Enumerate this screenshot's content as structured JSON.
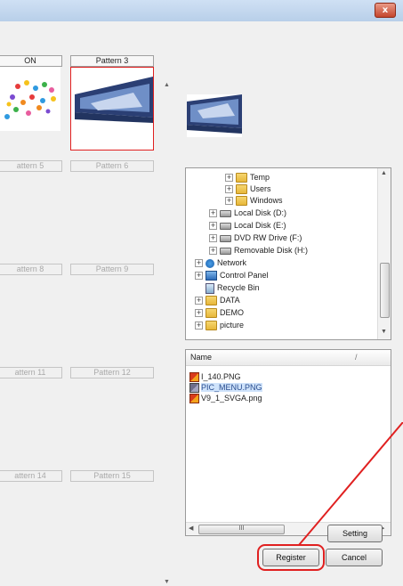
{
  "window": {
    "close_glyph": "x"
  },
  "patterns": [
    {
      "label": "ON",
      "state": "normal"
    },
    {
      "label": "Pattern 3",
      "state": "normal"
    },
    {
      "label": "attern 5",
      "state": "disabled"
    },
    {
      "label": "Pattern 6",
      "state": "disabled"
    },
    {
      "label": "attern 8",
      "state": "disabled"
    },
    {
      "label": "Pattern 9",
      "state": "disabled"
    },
    {
      "label": "attern 11",
      "state": "disabled"
    },
    {
      "label": "Pattern 12",
      "state": "disabled"
    },
    {
      "label": "attern 14",
      "state": "disabled"
    },
    {
      "label": "Pattern 15",
      "state": "disabled"
    }
  ],
  "tree": {
    "items": [
      {
        "label": "Temp",
        "icon": "folder"
      },
      {
        "label": "Users",
        "icon": "folder"
      },
      {
        "label": "Windows",
        "icon": "folder"
      },
      {
        "label": "Local Disk (D:)",
        "icon": "disk"
      },
      {
        "label": "Local Disk (E:)",
        "icon": "disk"
      },
      {
        "label": "DVD RW Drive (F:)",
        "icon": "dvd"
      },
      {
        "label": "Removable Disk (H:)",
        "icon": "disk"
      },
      {
        "label": "Network",
        "icon": "network"
      },
      {
        "label": "Control Panel",
        "icon": "control-panel"
      },
      {
        "label": "Recycle Bin",
        "icon": "recycle-bin"
      },
      {
        "label": "DATA",
        "icon": "folder"
      },
      {
        "label": "DEMO",
        "icon": "folder"
      },
      {
        "label": "picture",
        "icon": "folder"
      }
    ]
  },
  "file_list": {
    "header": "Name",
    "sort_glyph": "/",
    "files": [
      {
        "name": "I_140.PNG",
        "selected": false
      },
      {
        "name": "PIC_MENU.PNG",
        "selected": true
      },
      {
        "name": "V9_1_SVGA.png",
        "selected": false
      }
    ],
    "hscroll_grip": "III"
  },
  "buttons": {
    "setting": "Setting",
    "register": "Register",
    "cancel": "Cancel"
  },
  "colors": {
    "annotation": "#e02020",
    "selection": "#cfe3fb"
  }
}
